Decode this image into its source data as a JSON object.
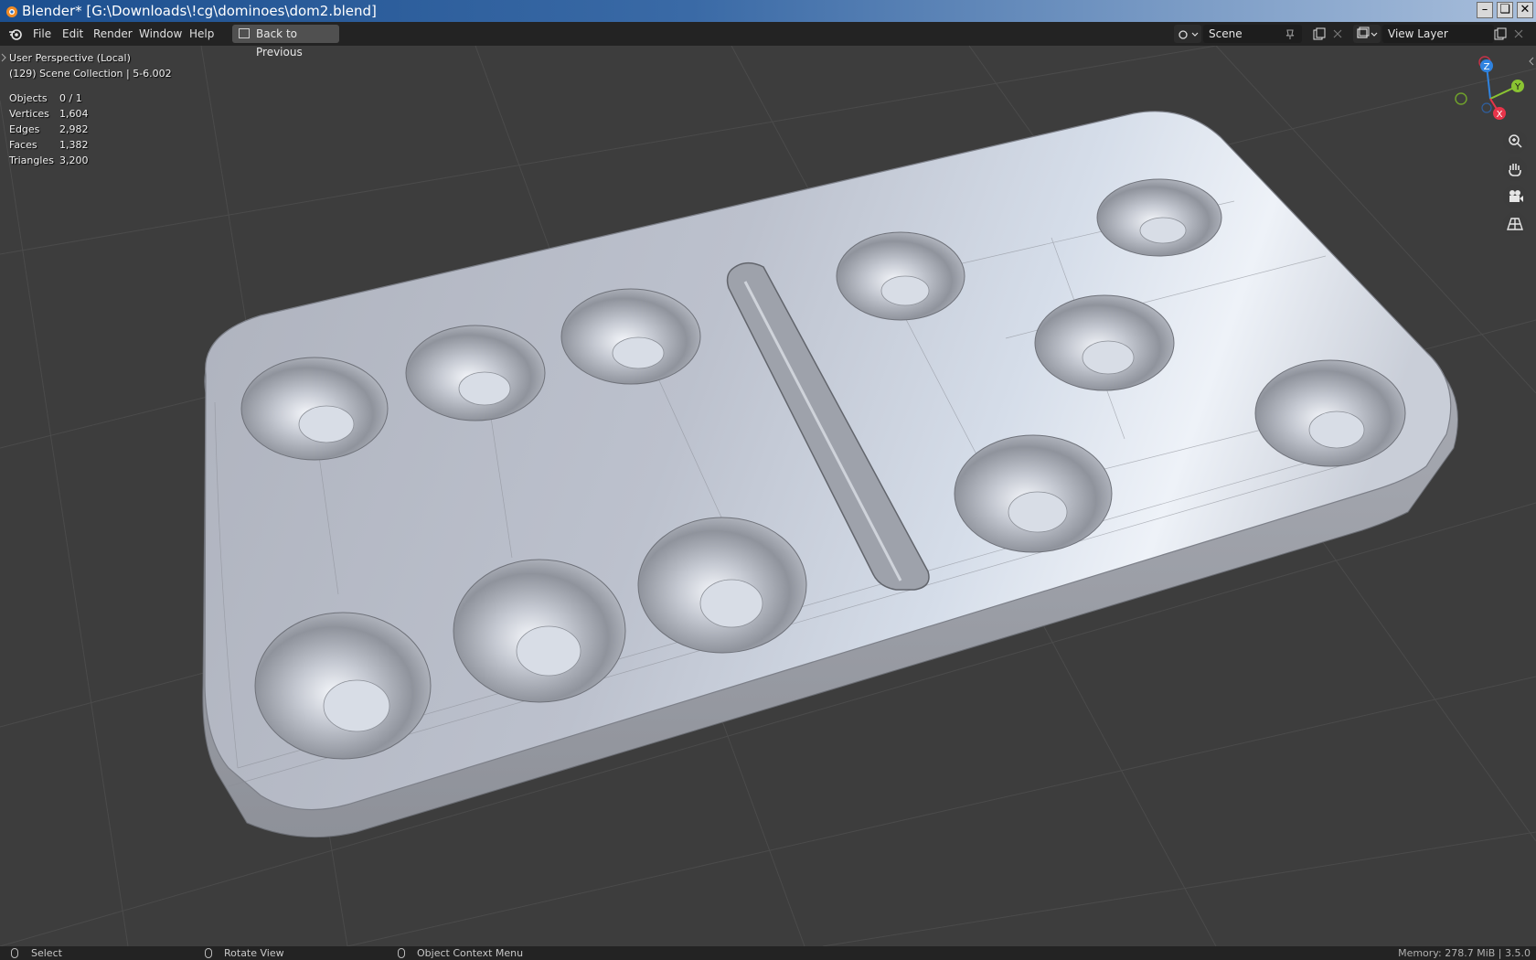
{
  "window": {
    "title": "Blender* [G:\\Downloads\\!cg\\dominoes\\dom2.blend]",
    "minimize": "–",
    "restore": "❏",
    "close": "✕"
  },
  "menu": {
    "items": [
      "File",
      "Edit",
      "Render",
      "Window",
      "Help"
    ],
    "back_button": "Back to Previous"
  },
  "header_right": {
    "scene_label": "Scene",
    "view_layer_label": "View Layer"
  },
  "viewport": {
    "perspective": "User Perspective (Local)",
    "collection": "(129) Scene Collection | 5-6.002",
    "stats": [
      {
        "label": "Objects",
        "value": "0 / 1"
      },
      {
        "label": "Vertices",
        "value": "1,604"
      },
      {
        "label": "Edges",
        "value": "2,982"
      },
      {
        "label": "Faces",
        "value": "1,382"
      },
      {
        "label": "Triangles",
        "value": "3,200"
      }
    ],
    "gizmo": {
      "x": "X",
      "y": "Y",
      "z": "Z"
    },
    "nav_icons": [
      "zoom-icon",
      "hand-pan-icon",
      "camera-icon",
      "perspective-grid-icon"
    ],
    "colors": {
      "background": "#3d3d3d",
      "x_axis": "#e8344a",
      "y_axis": "#8ac432",
      "z_axis": "#2f83e0"
    }
  },
  "status": {
    "select": "Select",
    "rotate": "Rotate View",
    "context": "Object Context Menu",
    "memory": "Memory: 278.7 MiB | 3.5.0"
  }
}
